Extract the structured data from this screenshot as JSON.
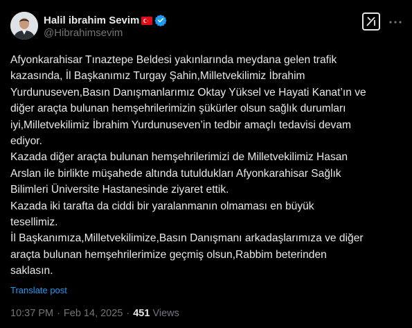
{
  "author": {
    "display_name": "Halil ibrahim Sevim",
    "handle": "@Hibrahimsevim",
    "flag_icon": "turkey-flag-icon",
    "verified_icon": "verified-badge-icon"
  },
  "header": {
    "grok_icon": "grok-icon",
    "more_icon": "more-options-icon"
  },
  "post": {
    "lines": [
      "Afyonkarahisar Tınaztepe Beldesi yakınlarında meydana gelen trafik",
      "kazasında, İl Başkanımız Turgay Şahin,Milletvekilimiz İbrahim",
      "Yurdunuseven,Basın Danışmanlarımız Oktay Yüksel ve Hayati Kanat’ın ve",
      "diğer araçta bulunan hemşehrilerimizin şükürler olsun sağlık durumları",
      "iyi,Milletvekilimiz İbrahim Yurdunuseven’in tedbir amaçlı tedavisi devam",
      "ediyor.",
      "Kazada diğer araçta bulunan hemşehrilerimizi de Milletvekilimiz Hasan",
      "Arslan ile birlikte müşahede altında tutuldukları Afyonkarahisar Sağlık",
      "Bilimleri Üniversite Hastanesinde ziyaret ettik.",
      "Kazada iki tarafta da ciddi bir yaralanmanın olmaması en büyük",
      "tesellimiz.",
      "İl Başkanımıza,Milletvekilimize,Basın Danışmanı arkadaşlarımıza ve diğer",
      "araçta bulunan hemşehrilerimize geçmiş olsun,Rabbim beterinden",
      "saklasın."
    ],
    "translate_label": "Translate post"
  },
  "meta": {
    "time": "10:37 PM",
    "separator": "·",
    "date": "Feb 14, 2025",
    "views_count": "451",
    "views_label": "Views"
  },
  "colors": {
    "background": "#000000",
    "text_primary": "#e7e9ea",
    "text_secondary": "#71767b",
    "link": "#1d9bf0",
    "verified": "#1d9bf0",
    "flag_red": "#e30a17"
  }
}
